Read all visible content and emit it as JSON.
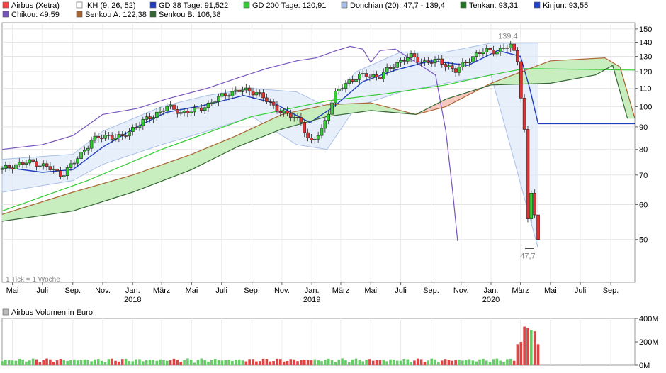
{
  "legend": [
    {
      "label": "Airbus (Xetra)",
      "color": "#ff4444"
    },
    {
      "label": "IKH (9, 26, 52)",
      "color": "#ffffff"
    },
    {
      "label": "GD 38 Tage: 91,522",
      "color": "#1f3fbf"
    },
    {
      "label": "GD 200 Tage: 120,91",
      "color": "#33cc33"
    },
    {
      "label": "Donchian (20): 47,7 - 139,4",
      "color": "#aac0e8"
    },
    {
      "label": "Tenkan: 93,31",
      "color": "#227722"
    },
    {
      "label": "Kinjun: 93,55",
      "color": "#2244cc"
    },
    {
      "label": "Chikou: 49,59",
      "color": "#7755bb"
    },
    {
      "label": "Senkou A: 122,38",
      "color": "#aa6633"
    },
    {
      "label": "Senkou B: 106,38",
      "color": "#336633"
    }
  ],
  "price_panel": {
    "y_ticks": [
      "150",
      "140",
      "130",
      "120",
      "110",
      "100",
      "90",
      "80",
      "70",
      "60",
      "50"
    ],
    "x_months": [
      "Mai",
      "Juli",
      "Sep.",
      "Nov.",
      "Jan.",
      "März",
      "Mai",
      "Juli",
      "Sep.",
      "Nov.",
      "Jan.",
      "März",
      "Mai",
      "Juli",
      "Sep.",
      "Nov.",
      "Jan.",
      "März",
      "Mai",
      "Juli",
      "Sep."
    ],
    "x_years": [
      "2018",
      "2019",
      "2020"
    ],
    "max_label": "139,4",
    "min_label": "47,7",
    "tick_note": "1 Tick = 1 Woche"
  },
  "volume_panel": {
    "title": "Airbus Volumen in Euro",
    "legend_color": "#bbbbbb",
    "y_ticks": [
      "400M",
      "200M",
      "0M"
    ]
  },
  "chart_data": [
    {
      "type": "line",
      "title": "Airbus (Xetra)",
      "y_scale": "log",
      "ylim": [
        40,
        155
      ],
      "y_ticks": [
        150,
        140,
        130,
        120,
        110,
        100,
        90,
        80,
        70,
        60,
        50
      ],
      "x_domain": [
        "2017-04-10",
        "2020-10-20"
      ],
      "x_ticks": [
        {
          "date": "2017-05-01",
          "label": "Mai"
        },
        {
          "date": "2017-07-01",
          "label": "Juli"
        },
        {
          "date": "2017-09-01",
          "label": "Sep."
        },
        {
          "date": "2017-11-01",
          "label": "Nov."
        },
        {
          "date": "2018-01-01",
          "label": "Jan."
        },
        {
          "date": "2018-03-01",
          "label": "März"
        },
        {
          "date": "2018-05-01",
          "label": "Mai"
        },
        {
          "date": "2018-07-01",
          "label": "Juli"
        },
        {
          "date": "2018-09-01",
          "label": "Sep."
        },
        {
          "date": "2018-11-01",
          "label": "Nov."
        },
        {
          "date": "2019-01-01",
          "label": "Jan."
        },
        {
          "date": "2019-03-01",
          "label": "März"
        },
        {
          "date": "2019-05-01",
          "label": "Mai"
        },
        {
          "date": "2019-07-01",
          "label": "Juli"
        },
        {
          "date": "2019-09-01",
          "label": "Sep."
        },
        {
          "date": "2019-11-01",
          "label": "Nov."
        },
        {
          "date": "2020-01-01",
          "label": "Jan."
        },
        {
          "date": "2020-03-01",
          "label": "März"
        },
        {
          "date": "2020-05-01",
          "label": "Mai"
        },
        {
          "date": "2020-07-01",
          "label": "Juli"
        },
        {
          "date": "2020-09-01",
          "label": "Sep."
        }
      ],
      "price_path": [
        [
          "2017-04-10",
          72
        ],
        [
          "2017-05-10",
          74
        ],
        [
          "2017-06-10",
          75
        ],
        [
          "2017-07-10",
          73
        ],
        [
          "2017-08-10",
          70
        ],
        [
          "2017-09-10",
          76
        ],
        [
          "2017-10-10",
          84
        ],
        [
          "2017-11-10",
          86
        ],
        [
          "2017-12-10",
          85
        ],
        [
          "2018-01-10",
          91
        ],
        [
          "2018-02-10",
          95
        ],
        [
          "2018-03-10",
          100
        ],
        [
          "2018-04-10",
          97
        ],
        [
          "2018-05-10",
          98
        ],
        [
          "2018-06-10",
          102
        ],
        [
          "2018-07-10",
          107
        ],
        [
          "2018-08-10",
          109
        ],
        [
          "2018-09-10",
          108
        ],
        [
          "2018-10-10",
          101
        ],
        [
          "2018-11-10",
          96
        ],
        [
          "2018-12-10",
          93
        ],
        [
          "2018-12-28",
          82
        ],
        [
          "2019-01-20",
          88
        ],
        [
          "2019-02-20",
          108
        ],
        [
          "2019-03-20",
          115
        ],
        [
          "2019-04-20",
          118
        ],
        [
          "2019-05-20",
          117
        ],
        [
          "2019-06-20",
          125
        ],
        [
          "2019-07-20",
          130
        ],
        [
          "2019-08-20",
          126
        ],
        [
          "2019-09-20",
          127
        ],
        [
          "2019-10-20",
          120
        ],
        [
          "2019-11-20",
          129
        ],
        [
          "2019-12-20",
          134
        ],
        [
          "2020-01-20",
          134
        ],
        [
          "2020-02-10",
          138
        ],
        [
          "2020-02-24",
          128
        ],
        [
          "2020-03-02",
          106
        ],
        [
          "2020-03-09",
          88
        ],
        [
          "2020-03-16",
          55
        ],
        [
          "2020-03-23",
          64
        ],
        [
          "2020-03-30",
          57
        ],
        [
          "2020-04-06",
          49.6
        ]
      ],
      "series": [
        {
          "name": "GD 200 Tage",
          "color": "#33cc33",
          "points": [
            [
              "2017-04-10",
              58
            ],
            [
              "2017-10-01",
              68
            ],
            [
              "2018-03-01",
              80
            ],
            [
              "2018-09-01",
              95
            ],
            [
              "2019-02-01",
              103
            ],
            [
              "2019-06-01",
              107
            ],
            [
              "2019-10-01",
              112
            ],
            [
              "2020-01-01",
              118
            ],
            [
              "2020-03-10",
              122
            ],
            [
              "2020-10-20",
              121
            ]
          ]
        },
        {
          "name": "GD 38 Tage",
          "color": "#1f3fbf",
          "points": [
            [
              "2017-04-10",
              73
            ],
            [
              "2017-07-01",
              71
            ],
            [
              "2017-09-01",
              72
            ],
            [
              "2017-11-01",
              81
            ],
            [
              "2018-01-10",
              90
            ],
            [
              "2018-03-10",
              97
            ],
            [
              "2018-06-01",
              101
            ],
            [
              "2018-08-15",
              106
            ],
            [
              "2018-10-15",
              102
            ],
            [
              "2018-12-28",
              92
            ],
            [
              "2019-02-15",
              100
            ],
            [
              "2019-04-15",
              114
            ],
            [
              "2019-06-20",
              121
            ],
            [
              "2019-09-01",
              127
            ],
            [
              "2019-11-15",
              124
            ],
            [
              "2020-01-15",
              134
            ],
            [
              "2020-03-01",
              130
            ],
            [
              "2020-03-20",
              110
            ],
            [
              "2020-04-06",
              91.5
            ],
            [
              "2020-10-20",
              91.5
            ]
          ]
        },
        {
          "name": "Chikou",
          "color": "#7755bb",
          "points": [
            [
              "2017-04-10",
              80
            ],
            [
              "2017-07-01",
              82
            ],
            [
              "2017-09-01",
              86
            ],
            [
              "2017-11-01",
              96
            ],
            [
              "2018-01-10",
              99
            ],
            [
              "2018-03-10",
              104
            ],
            [
              "2018-06-01",
              110
            ],
            [
              "2018-08-01",
              116
            ],
            [
              "2018-10-01",
              122
            ],
            [
              "2018-12-01",
              127
            ],
            [
              "2019-01-10",
              129
            ],
            [
              "2019-02-20",
              134
            ],
            [
              "2019-03-20",
              137
            ],
            [
              "2019-04-15",
              135
            ],
            [
              "2019-05-01",
              126
            ],
            [
              "2019-05-20",
              134
            ],
            [
              "2019-06-20",
              135
            ],
            [
              "2019-09-10",
              118
            ],
            [
              "2019-10-01",
              88
            ],
            [
              "2019-10-15",
              64
            ],
            [
              "2019-10-25",
              49.6
            ]
          ]
        },
        {
          "name": "Senkou A",
          "color": "#aa6633",
          "points": [
            [
              "2017-04-10",
              57
            ],
            [
              "2017-09-01",
              64
            ],
            [
              "2018-01-01",
              70
            ],
            [
              "2018-05-01",
              78
            ],
            [
              "2018-08-01",
              86
            ],
            [
              "2018-11-01",
              96
            ],
            [
              "2019-02-01",
              101
            ],
            [
              "2019-05-01",
              102
            ],
            [
              "2019-08-01",
              96
            ],
            [
              "2019-10-01",
              100
            ],
            [
              "2020-01-01",
              113
            ],
            [
              "2020-05-01",
              127
            ],
            [
              "2020-08-20",
              129
            ],
            [
              "2020-09-20",
              123
            ],
            [
              "2020-10-20",
              94
            ]
          ]
        },
        {
          "name": "Senkou B",
          "color": "#336633",
          "points": [
            [
              "2017-04-10",
              55
            ],
            [
              "2017-09-01",
              58
            ],
            [
              "2018-01-01",
              64
            ],
            [
              "2018-05-01",
              72
            ],
            [
              "2018-08-01",
              81
            ],
            [
              "2018-11-01",
              89
            ],
            [
              "2019-02-01",
              95
            ],
            [
              "2019-05-01",
              98
            ],
            [
              "2019-08-01",
              96
            ],
            [
              "2019-10-01",
              104
            ],
            [
              "2020-01-01",
              112
            ],
            [
              "2020-05-01",
              113
            ],
            [
              "2020-08-01",
              118
            ],
            [
              "2020-09-05",
              124
            ],
            [
              "2020-10-05",
              94
            ]
          ]
        }
      ],
      "donchian_band": {
        "upper": [
          [
            "2017-04-10",
            76
          ],
          [
            "2017-09-01",
            78
          ],
          [
            "2017-11-01",
            88
          ],
          [
            "2018-03-01",
            100
          ],
          [
            "2018-06-01",
            106
          ],
          [
            "2018-09-01",
            110
          ],
          [
            "2018-12-01",
            108
          ],
          [
            "2019-02-01",
            100
          ],
          [
            "2019-04-01",
            120
          ],
          [
            "2019-07-01",
            133
          ],
          [
            "2019-10-01",
            133
          ],
          [
            "2020-01-01",
            139.4
          ],
          [
            "2020-04-06",
            139.4
          ]
        ],
        "lower": [
          [
            "2017-04-10",
            64
          ],
          [
            "2017-09-01",
            68
          ],
          [
            "2017-11-01",
            74
          ],
          [
            "2018-03-01",
            82
          ],
          [
            "2018-06-01",
            88
          ],
          [
            "2018-09-01",
            95
          ],
          [
            "2018-12-01",
            82
          ],
          [
            "2019-02-01",
            80
          ],
          [
            "2019-04-01",
            100
          ],
          [
            "2019-07-01",
            108
          ],
          [
            "2019-10-01",
            113
          ],
          [
            "2020-01-01",
            118
          ],
          [
            "2020-04-06",
            47.7
          ]
        ]
      },
      "max_point": {
        "date": "2020-02-10",
        "value": 139.4
      },
      "min_point": {
        "date": "2020-03-16",
        "value": 47.7
      }
    },
    {
      "type": "bar",
      "title": "Airbus Volumen in Euro",
      "ylim": [
        0,
        400
      ],
      "y_unit": "M",
      "y_ticks": [
        400,
        200,
        0
      ],
      "volume_base_M": 40,
      "volume_spikes_M": [
        [
          "2020-02-24",
          180
        ],
        [
          "2020-03-02",
          200
        ],
        [
          "2020-03-09",
          330
        ],
        [
          "2020-03-16",
          320
        ],
        [
          "2020-03-23",
          300
        ],
        [
          "2020-03-30",
          290
        ],
        [
          "2020-04-06",
          180
        ]
      ]
    }
  ]
}
